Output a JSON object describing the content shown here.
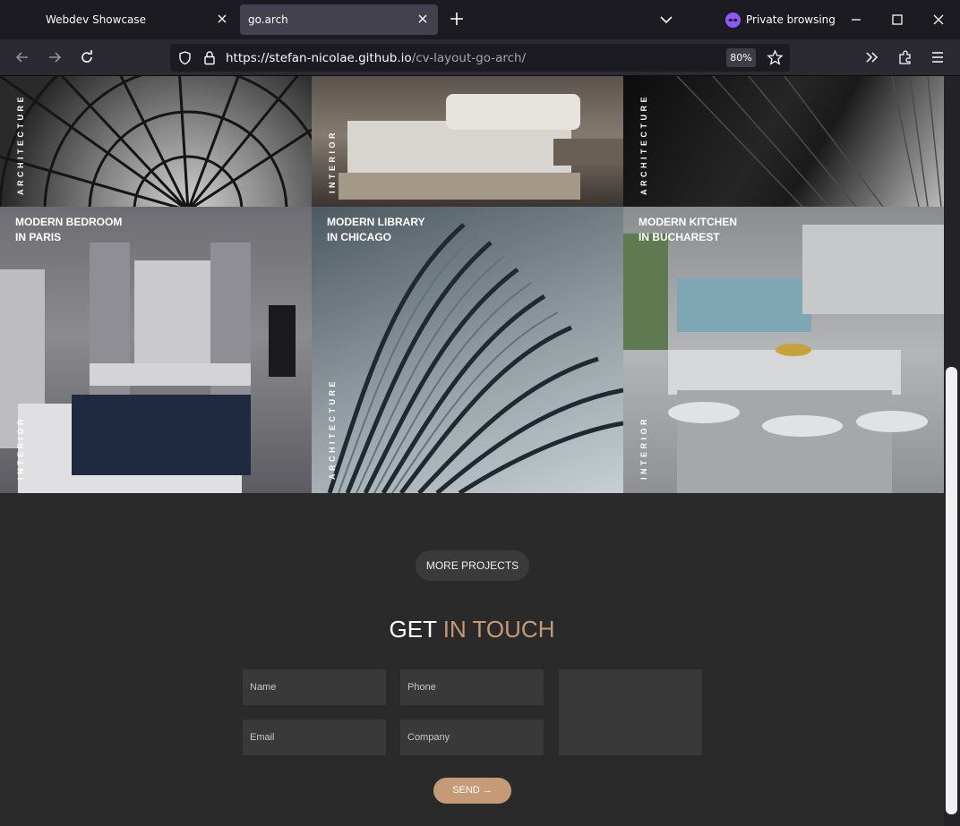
{
  "browser": {
    "tabs": [
      {
        "label": "Webdev Showcase",
        "active": false
      },
      {
        "label": "go.arch",
        "active": true
      }
    ],
    "private_label": "Private browsing",
    "url_host": "https://stefan-nicolae.github.io",
    "url_path": "/cv-layout-go-arch/",
    "zoom": "80%"
  },
  "gallery": {
    "top_row": [
      {
        "category": "ARCHITECTURE"
      },
      {
        "category": "INTERIOR"
      },
      {
        "category": "ARCHITECTURE"
      }
    ],
    "projects": [
      {
        "title_line1": "MODERN BEDROOM",
        "title_line2": "IN PARIS",
        "category": "INTERIOR"
      },
      {
        "title_line1": "MODERN LIBRARY",
        "title_line2": "IN CHICAGO",
        "category": "ARCHITECTURE"
      },
      {
        "title_line1": "MODERN KITCHEN",
        "title_line2": "IN BUCHAREST",
        "category": "INTERIOR"
      }
    ]
  },
  "more_projects_label": "MORE PROJECTS",
  "contact": {
    "heading_white": "GET",
    "heading_accent": "IN TOUCH",
    "name_placeholder": "Name",
    "phone_placeholder": "Phone",
    "email_placeholder": "Email",
    "company_placeholder": "Company",
    "send_label": "SEND →"
  },
  "colors": {
    "accent": "#c49a77",
    "page_bg": "#2b2a2b",
    "field_bg": "#3a393a"
  }
}
